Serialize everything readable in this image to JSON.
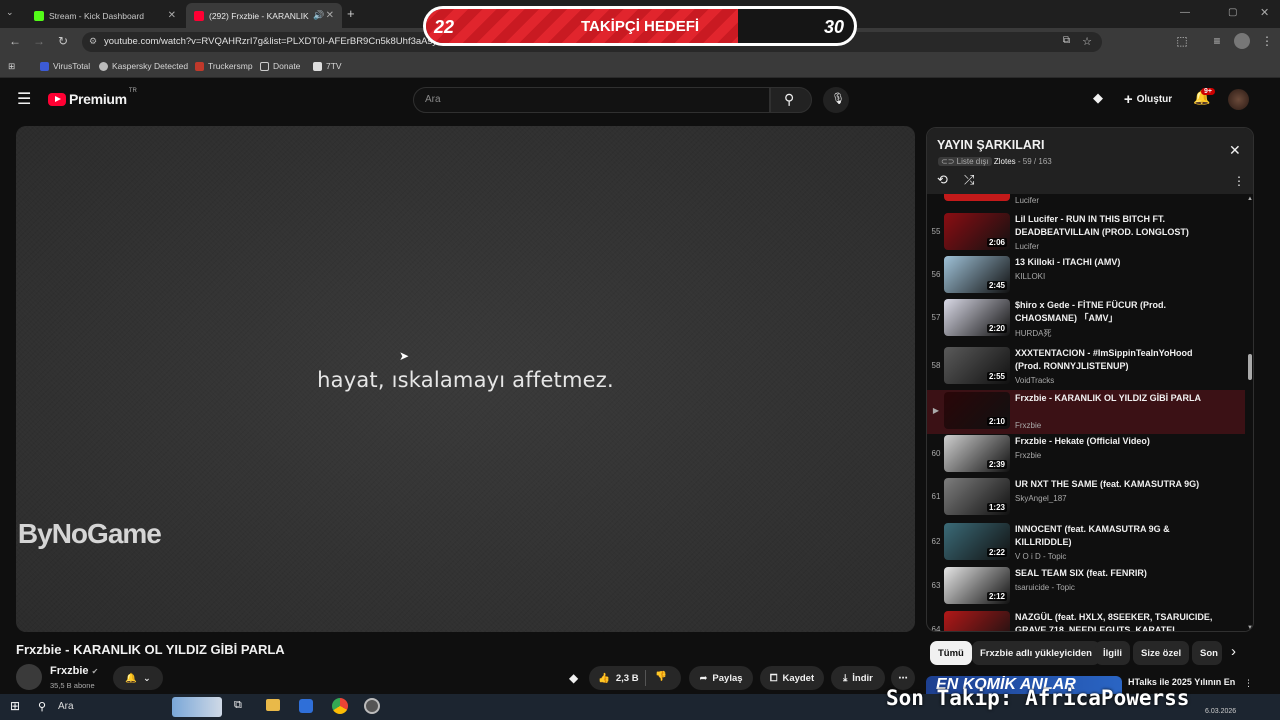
{
  "browser": {
    "tabs": [
      {
        "label": "Stream - Kick Dashboard",
        "color": "#53fc18"
      },
      {
        "label": "(292) Frxzbie - KARANLIK O",
        "color": "#ff0033"
      }
    ],
    "new_tab": "+",
    "url": "youtube.com/watch?v=RVQAHRzrI7g&list=PLXDT0I-AFErBR9Cn5k8Uhf3aAsyAq",
    "bookmarks": [
      "VirusTotal",
      "Kaspersky Detected",
      "Truckersmp",
      "Donate",
      "7TV"
    ]
  },
  "goal_overlay": {
    "current": "22",
    "title": "TAKİPÇİ HEDEFİ",
    "target": "30",
    "progress": 0.73
  },
  "youtube": {
    "logo": "Premium",
    "region": "TR",
    "search_placeholder": "Ara",
    "create_label": "Oluştur",
    "notif_count": "9+"
  },
  "player": {
    "caption": "hayat, ıskalamayı affetmez.",
    "watermark": "ByNoGame"
  },
  "video": {
    "title": "Frxzbie - KARANLIK OL YILDIZ GİBİ PARLA",
    "channel": "Frxzbie",
    "subscribers": "35,5 B abone",
    "likes": "2,3 B",
    "share": "Paylaş",
    "save": "Kaydet",
    "download": "İndir"
  },
  "playlist": {
    "title": "YAYIN ŞARKILARI",
    "meta_prefix": "Liste dışı",
    "owner": "Zlotes",
    "position": "59 / 163",
    "top_partial_channel": "Lucifer",
    "items": [
      {
        "idx": "55",
        "title": "Lil Lucifer - RUN IN THIS BITCH FT. DEADBEATVILLAIN (PROD. LONGLOST)",
        "channel": "Lucifer",
        "dur": "2:06",
        "color": "#8b0d12"
      },
      {
        "idx": "56",
        "title": "13 Killoki - ITACHI (AMV)",
        "channel": "KILLOKI",
        "dur": "2:45",
        "color": "#9fc2d8"
      },
      {
        "idx": "57",
        "title": "$hiro x Gede - FİTNE FÜCUR (Prod. CHAOSMANE) 「AMV」",
        "channel": "HURDA死",
        "dur": "2:20",
        "color": "#d9d9e6"
      },
      {
        "idx": "58",
        "title": "XXXTENTACION - #ImSippinTeaInYoHood (Prod. RONNYJLISTENUP)",
        "channel": "VoidTracks",
        "dur": "2:55",
        "color": "#5a5a5a"
      },
      {
        "idx": "▶",
        "title": "Frxzbie - KARANLIK OL YILDIZ GİBİ PARLA",
        "channel": "Frxzbie",
        "dur": "2:10",
        "color": "#2a0608"
      },
      {
        "idx": "60",
        "title": "Frxzbie - Hekate (Official Video)",
        "channel": "Frxzbie",
        "dur": "2:39",
        "color": "#cfcfcf"
      },
      {
        "idx": "61",
        "title": "UR NXT THE SAME (feat. KAMASUTRA 9G)",
        "channel": "SkyAngel_187",
        "dur": "1:23",
        "color": "#7d7d7d"
      },
      {
        "idx": "62",
        "title": "INNOCENT (feat. KAMASUTRA 9G & KILLRIDDLE)",
        "channel": "V O i D - Topic",
        "dur": "2:22",
        "color": "#3b6b78"
      },
      {
        "idx": "63",
        "title": "SEAL TEAM SIX (feat. FENRIR)",
        "channel": "tsaruicide - Topic",
        "dur": "2:12",
        "color": "#e6e6e6"
      },
      {
        "idx": "64",
        "title": "NAZGÜL (feat. HXLX, 8SEEKER, TSARUICIDE, GRAVE 718, NEEDLEGUTS, KARATEL",
        "channel": "",
        "dur": "",
        "color": "#b21818"
      }
    ]
  },
  "chips": [
    "Tümü",
    "Frxzbie adlı yükleyiciden",
    "İlgili",
    "Size özel",
    "Son"
  ],
  "rec_preview": {
    "title": "HTalks ile 2025 Yılının En",
    "date": "6.03.2026"
  },
  "stream_overlay": {
    "follow_text": "Son Takip: AfricaPowerss"
  },
  "taskbar": {
    "search": "Ara"
  },
  "colors": {
    "accent_red": "#ff0033",
    "goal_red": "#e1252d",
    "bg": "#0f0f0f"
  }
}
